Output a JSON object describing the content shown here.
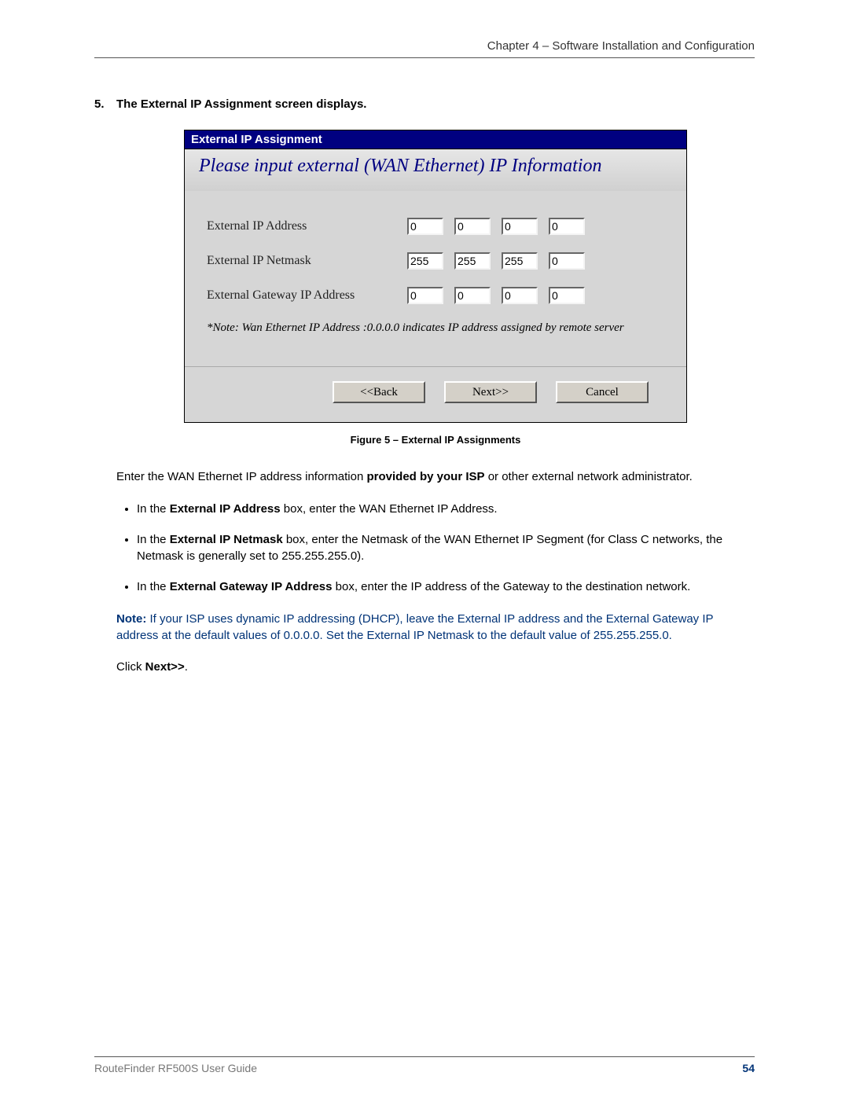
{
  "header": {
    "chapter": "Chapter 4 – Software Installation and Configuration"
  },
  "step": {
    "number": "5.",
    "title": "The External IP Assignment screen displays."
  },
  "dialog": {
    "title": "External IP Assignment",
    "banner": "Please input external (WAN Ethernet) IP Information",
    "rows": {
      "ext_ip": {
        "label": "External IP Address",
        "octets": [
          "0",
          "0",
          "0",
          "0"
        ]
      },
      "ext_netmask": {
        "label": "External IP Netmask",
        "octets": [
          "255",
          "255",
          "255",
          "0"
        ]
      },
      "ext_gw": {
        "label": "External Gateway IP Address",
        "octets": [
          "0",
          "0",
          "0",
          "0"
        ]
      }
    },
    "note": "*Note: Wan Ethernet IP Address :0.0.0.0 indicates IP address assigned by remote server",
    "buttons": {
      "back": "<<Back",
      "next": "Next>>",
      "cancel": "Cancel"
    }
  },
  "caption": "Figure 5 – External IP Assignments",
  "body": {
    "intro_pre": "Enter the WAN Ethernet IP address information ",
    "intro_bold": "provided by your ISP",
    "intro_post": " or other external network administrator.",
    "bullets": {
      "b1_pre": "In the ",
      "b1_bold": "External IP Address",
      "b1_post": " box, enter the WAN Ethernet IP Address.",
      "b2_pre": "In the ",
      "b2_bold": "External IP Netmask",
      "b2_post": " box, enter the Netmask of the WAN Ethernet IP Segment (for Class C networks, the Netmask is generally set to 255.255.255.0).",
      "b3_pre": "In the ",
      "b3_bold": "External Gateway IP Address",
      "b3_post": " box, enter the IP address of the Gateway to the destination network."
    },
    "note_bold": "Note:",
    "note_text": " If your ISP uses dynamic IP addressing (DHCP), leave the External IP address and the External Gateway IP address at the default values of 0.0.0.0.  Set the External IP Netmask to the default value of 255.255.255.0.",
    "click_pre": "Click ",
    "click_bold": "Next>>",
    "click_post": "."
  },
  "footer": {
    "left": "RouteFinder RF500S User Guide",
    "page": "54"
  }
}
